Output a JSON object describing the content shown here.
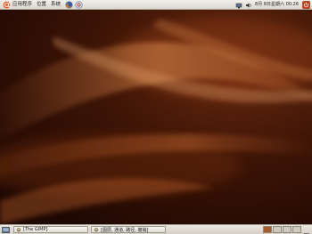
{
  "top_panel": {
    "menus": [
      "应用程序",
      "位置",
      "系统"
    ],
    "clock": "8月 8日星期六 00:26",
    "icons": [
      "ubuntu-logo-icon",
      "firefox-icon",
      "help-icon",
      "network-icon",
      "volume-icon",
      "power-icon"
    ]
  },
  "bottom_panel": {
    "tasks": [
      {
        "label": "[The GIMP]",
        "icon": "gimp-icon"
      },
      {
        "label": "[图层, 通道, 路径, 撤销]",
        "icon": "gimp-icon"
      }
    ],
    "workspaces_count": 4,
    "active_workspace": 1,
    "icons": [
      "show-desktop-icon",
      "trash-icon"
    ]
  },
  "colors": {
    "desktop_base": "#2a0c04",
    "desktop_glow": "#b05a28",
    "panel": "#e6e2da",
    "accent": "#d84f1a"
  }
}
